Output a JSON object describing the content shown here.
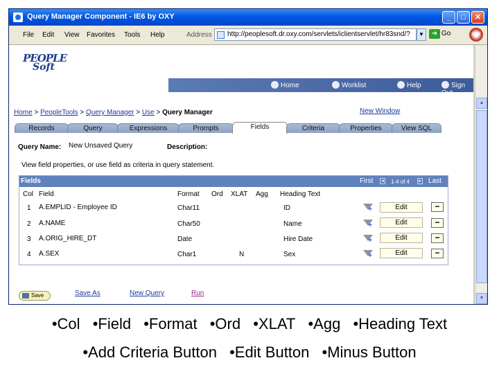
{
  "window": {
    "title": "Query Manager Component - IE6 by OXY",
    "brand_badge": "OXY"
  },
  "menu": {
    "items": [
      "File",
      "Edit",
      "View",
      "Favorites",
      "Tools",
      "Help"
    ]
  },
  "address": {
    "label": "Address",
    "url": "http://peoplesoft.dr.oxy.com/servlets/iclientservlet/hr83snd/?",
    "go_label": "Go"
  },
  "logo": {
    "line1": "PEOPLE",
    "line2": "Soft"
  },
  "nav": {
    "items": [
      "Home",
      "Worklist",
      "Help",
      "Sign Out"
    ]
  },
  "breadcrumb": [
    "Home",
    "PeopleTools",
    "Query Manager",
    "Use",
    "Query Manager"
  ],
  "breadcrumb_sep": ">",
  "new_window": "New Window",
  "tabs": [
    "Records",
    "Query",
    "Expressions",
    "Prompts",
    "Fields",
    "Criteria",
    "Properties",
    "View SQL"
  ],
  "query_name_label": "Query Name:",
  "query_name_value": "New Unsaved Query",
  "description_label": "Description:",
  "instructions": "View field properties, or use field as criteria in query statement.",
  "grid": {
    "title": "Fields",
    "first": "First",
    "range": "1-4 of 4",
    "last": "Last",
    "columns": [
      "Col",
      "Field",
      "Format",
      "Ord",
      "XLAT",
      "Agg",
      "Heading Text"
    ],
    "rows": [
      {
        "col": "1",
        "field": "A.EMPLID - Employee ID",
        "format": "Char11",
        "ord": "",
        "xlat": "",
        "agg": "",
        "heading": "ID"
      },
      {
        "col": "2",
        "field": "A.NAME",
        "format": "Char50",
        "ord": "",
        "xlat": "",
        "agg": "",
        "heading": "Name"
      },
      {
        "col": "3",
        "field": "A.ORIG_HIRE_DT",
        "format": "Date",
        "ord": "",
        "xlat": "",
        "agg": "",
        "heading": "Hire Date"
      },
      {
        "col": "4",
        "field": "A.SEX",
        "format": "Char1",
        "ord": "",
        "xlat": "N",
        "agg": "",
        "heading": "Sex"
      }
    ],
    "edit_label": "Edit",
    "minus_label": "−"
  },
  "actions": {
    "save": "Save",
    "save_as": "Save As",
    "new_query": "New Query",
    "run": "Run"
  },
  "caption": {
    "line1": [
      "•Col",
      "•Field",
      "•Format",
      "•Ord",
      "•XLAT",
      "•Agg",
      "•Heading Text"
    ],
    "line2": [
      "•Add Criteria Button",
      "•Edit Button",
      "•Minus Button"
    ]
  }
}
